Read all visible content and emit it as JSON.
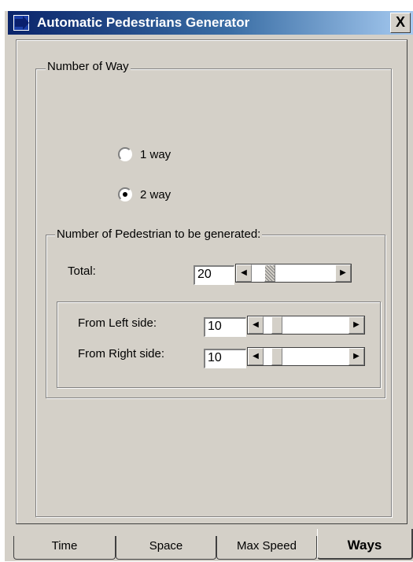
{
  "window": {
    "title": "Automatic Pedestrians Generator",
    "close_glyph": "X"
  },
  "group_way": {
    "legend": "Number of Way",
    "options": [
      {
        "label": "1 way",
        "selected": false
      },
      {
        "label": "2 way",
        "selected": true
      }
    ]
  },
  "group_pedestrians": {
    "legend": "Number of Pedestrian to be generated:",
    "total": {
      "label": "Total:",
      "value": "20"
    },
    "left": {
      "label": "From Left side:",
      "value": "10"
    },
    "right": {
      "label": "From Right side:",
      "value": "10"
    }
  },
  "scroll_arrows": {
    "left": "◀",
    "right": "▶"
  },
  "tabs": [
    {
      "label": "Time",
      "active": false
    },
    {
      "label": "Space",
      "active": false
    },
    {
      "label": "Max Speed",
      "active": false
    },
    {
      "label": "Ways",
      "active": true
    }
  ],
  "colors": {
    "face": "#d4d0c8",
    "title_start": "#0a246a",
    "title_end": "#a6caf0"
  }
}
